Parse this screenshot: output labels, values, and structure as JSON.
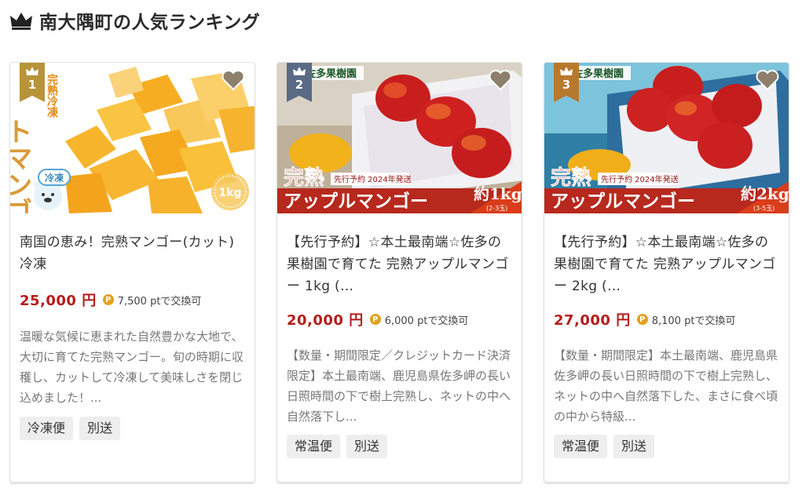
{
  "heading": {
    "title": "南大隅町の人気ランキング",
    "icon": "crown-icon"
  },
  "colors": {
    "gold": "#b7943a",
    "slate": "#5a6a84",
    "bronze": "#b7792d",
    "price": "#b71c1c",
    "point": "#e4a11b"
  },
  "cards": [
    {
      "rank": "1",
      "image_text": {
        "vertical": "完熟冷凍",
        "brand": "トマンゴー",
        "freeze": "冷凍",
        "weight": "1kg"
      },
      "title": "南国の恵み！完熟マンゴー(カット)冷凍",
      "price": "25,000 円",
      "points": "7,500 ptで交換可",
      "description": "温暖な気候に恵まれた自然豊かな大地で、大切に育てた完熟マンゴー。旬の時期に収穫し、カットして冷凍して美味しさを閉じ込めました！...",
      "tags": [
        "冷凍便",
        "別送"
      ]
    },
    {
      "rank": "2",
      "image_text": {
        "farm": "佐多果樹園",
        "ripe": "完熟",
        "preorder": "先行予約 2024年発送",
        "product": "アップルマンゴー",
        "weight": "約1kg",
        "count": "(2-3玉)"
      },
      "title": "【先行予約】☆本土最南端☆佐多の果樹園で育てた 完熟アップルマンゴー 1kg (…",
      "price": "20,000 円",
      "points": "6,000 ptで交換可",
      "description": "【数量・期間限定／クレジットカード決済限定】本土最南端、鹿児島県佐多岬の長い日照時間の下で樹上完熟し、ネットの中へ自然落下し...",
      "tags": [
        "常温便",
        "別送"
      ]
    },
    {
      "rank": "3",
      "image_text": {
        "farm": "佐多果樹園",
        "ripe": "完熟",
        "preorder": "先行予約 2024年発送",
        "product": "アップルマンゴー",
        "weight": "約2kg",
        "count": "(3-5玉)"
      },
      "title": "【先行予約】☆本土最南端☆佐多の果樹園で育てた 完熟アップルマンゴー 2kg (…",
      "price": "27,000 円",
      "points": "8,100 ptで交換可",
      "description": "【数量・期間限定】本土最南端、鹿児島県佐多岬の長い日照時間の下で樹上完熟し、ネットの中へ自然落下した、まさに食べ頃の中から特級...",
      "tags": [
        "常温便",
        "別送"
      ]
    }
  ]
}
